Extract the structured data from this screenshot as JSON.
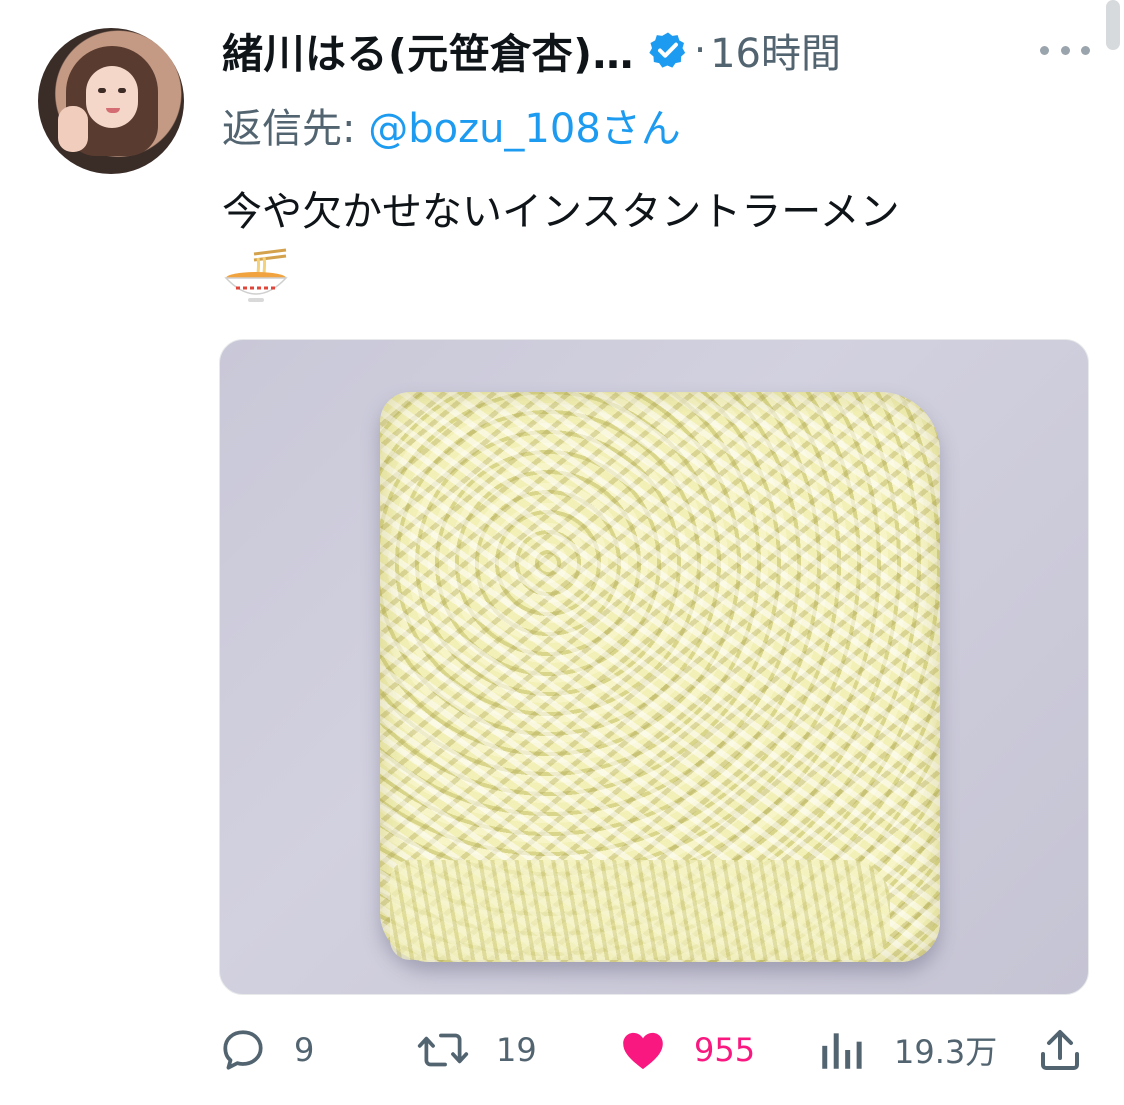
{
  "tweet": {
    "author_name": "緒川はる(元笹倉杏)…",
    "time": "16時間",
    "separator": "·",
    "reply_prefix": "返信先: ",
    "reply_handle": "@bozu_108さん",
    "text": "今や欠かせないインスタントラーメン",
    "emoji": "ramen-bowl"
  },
  "actions": {
    "replies": "9",
    "retweets": "19",
    "likes": "955",
    "views": "19.3万"
  },
  "colors": {
    "accent": "#1d9bf0",
    "like": "#f91880",
    "muted": "#536471"
  }
}
